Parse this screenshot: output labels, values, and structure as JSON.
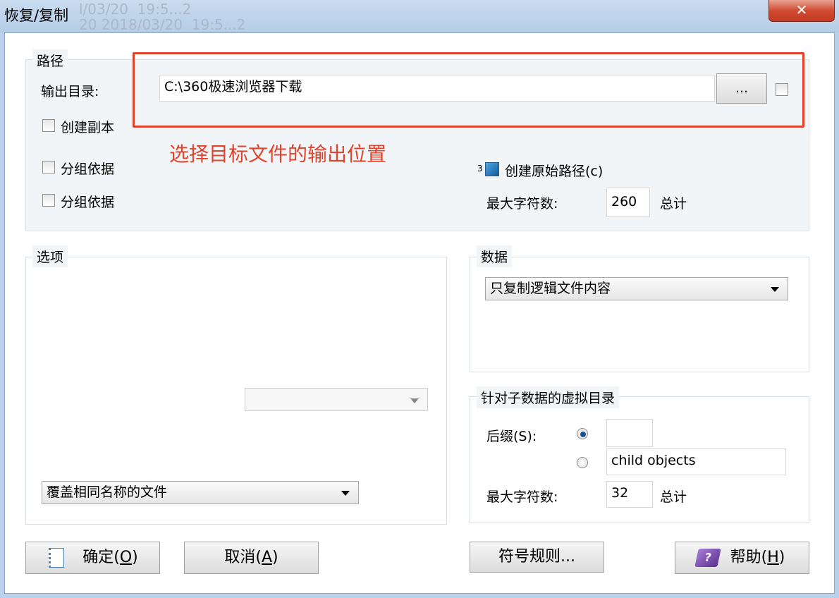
{
  "window": {
    "title": "恢复/复制",
    "background_text": "l/03/20  19:5...2\n20 2018/03/20  19:5...2"
  },
  "path_group": {
    "label": "路径",
    "output_dir_label": "输出目录:",
    "output_dir_value": "C:\\360极速浏览器下载",
    "browse_label": "...",
    "create_copy_label": "创建副本",
    "group_by_1_label": "分组依据",
    "group_by_2_label": "分组依据",
    "create_original_path_prefix": "3",
    "create_original_path_label": "创建原始路径(c)",
    "max_chars_label": "最大字符数:",
    "max_chars_value": "260",
    "max_chars_suffix": "总计"
  },
  "annotation": {
    "text": "选择目标文件的输出位置",
    "color": "#e0442c"
  },
  "options_group": {
    "label": "选项",
    "empty_combo_value": "",
    "overwrite_combo_value": "覆盖相同名称的文件"
  },
  "data_group": {
    "label": "数据",
    "combo_value": "只复制逻辑文件内容"
  },
  "virtual_dir_group": {
    "label": "针对子数据的虚拟目录",
    "suffix_label": "后缀(S):",
    "suffix_value": "",
    "child_objects_value": "child objects",
    "max_chars_label": "最大字符数:",
    "max_chars_value": "32",
    "max_chars_suffix": "总计"
  },
  "buttons": {
    "ok_label": "确定(",
    "ok_key": "O",
    "ok_end": ")",
    "cancel_label": "取消(",
    "cancel_key": "A",
    "cancel_end": ")",
    "symbol_rules_label": "符号规则...",
    "help_label": "帮助(",
    "help_key": "H",
    "help_end": ")"
  },
  "colors": {
    "titlebar": "#c2d6ee",
    "close_button": "#c9452c",
    "highlight_box": "#e0442c",
    "accent": "#1e5fa8"
  }
}
